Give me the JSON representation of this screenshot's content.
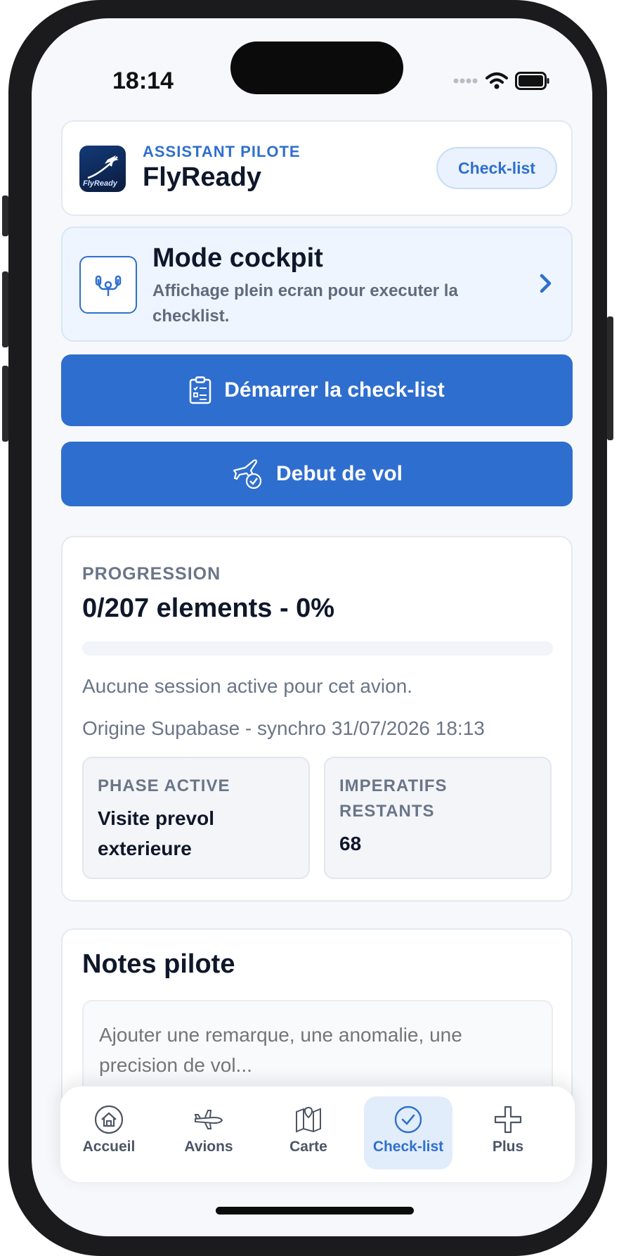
{
  "status_bar": {
    "time": "18:14"
  },
  "header": {
    "eyebrow": "ASSISTANT PILOTE",
    "title": "FlyReady",
    "logo_text": "FlyReady",
    "checklist_pill": "Check-list"
  },
  "cockpit": {
    "title": "Mode cockpit",
    "description": "Affichage plein ecran pour executer la checklist."
  },
  "actions": {
    "start_label": "Démarrer la check-list",
    "flight_label": "Debut de vol"
  },
  "progress": {
    "label": "PROGRESSION",
    "summary": "0/207 elements - 0%",
    "percent": 0,
    "session_text": "Aucune session active pour cet avion.",
    "sync_text": "Origine Supabase - synchro 31/07/2026 18:13",
    "phase_label": "PHASE ACTIVE",
    "phase_value": "Visite prevol exterieure",
    "imperatives_label": "IMPERATIFS RESTANTS",
    "imperatives_value": "68"
  },
  "notes": {
    "title": "Notes pilote",
    "placeholder": "Ajouter une remarque, une anomalie, une precision de vol..."
  },
  "tabs": [
    {
      "label": "Accueil",
      "icon": "home-icon",
      "active": false
    },
    {
      "label": "Avions",
      "icon": "airplane-icon",
      "active": false
    },
    {
      "label": "Carte",
      "icon": "map-icon",
      "active": false
    },
    {
      "label": "Check-list",
      "icon": "check-circle-icon",
      "active": true
    },
    {
      "label": "Plus",
      "icon": "plus-icon",
      "active": false
    }
  ],
  "colors": {
    "accent": "#2e6ecf",
    "text_dark": "#0f172a",
    "text_muted": "#6b7588"
  }
}
